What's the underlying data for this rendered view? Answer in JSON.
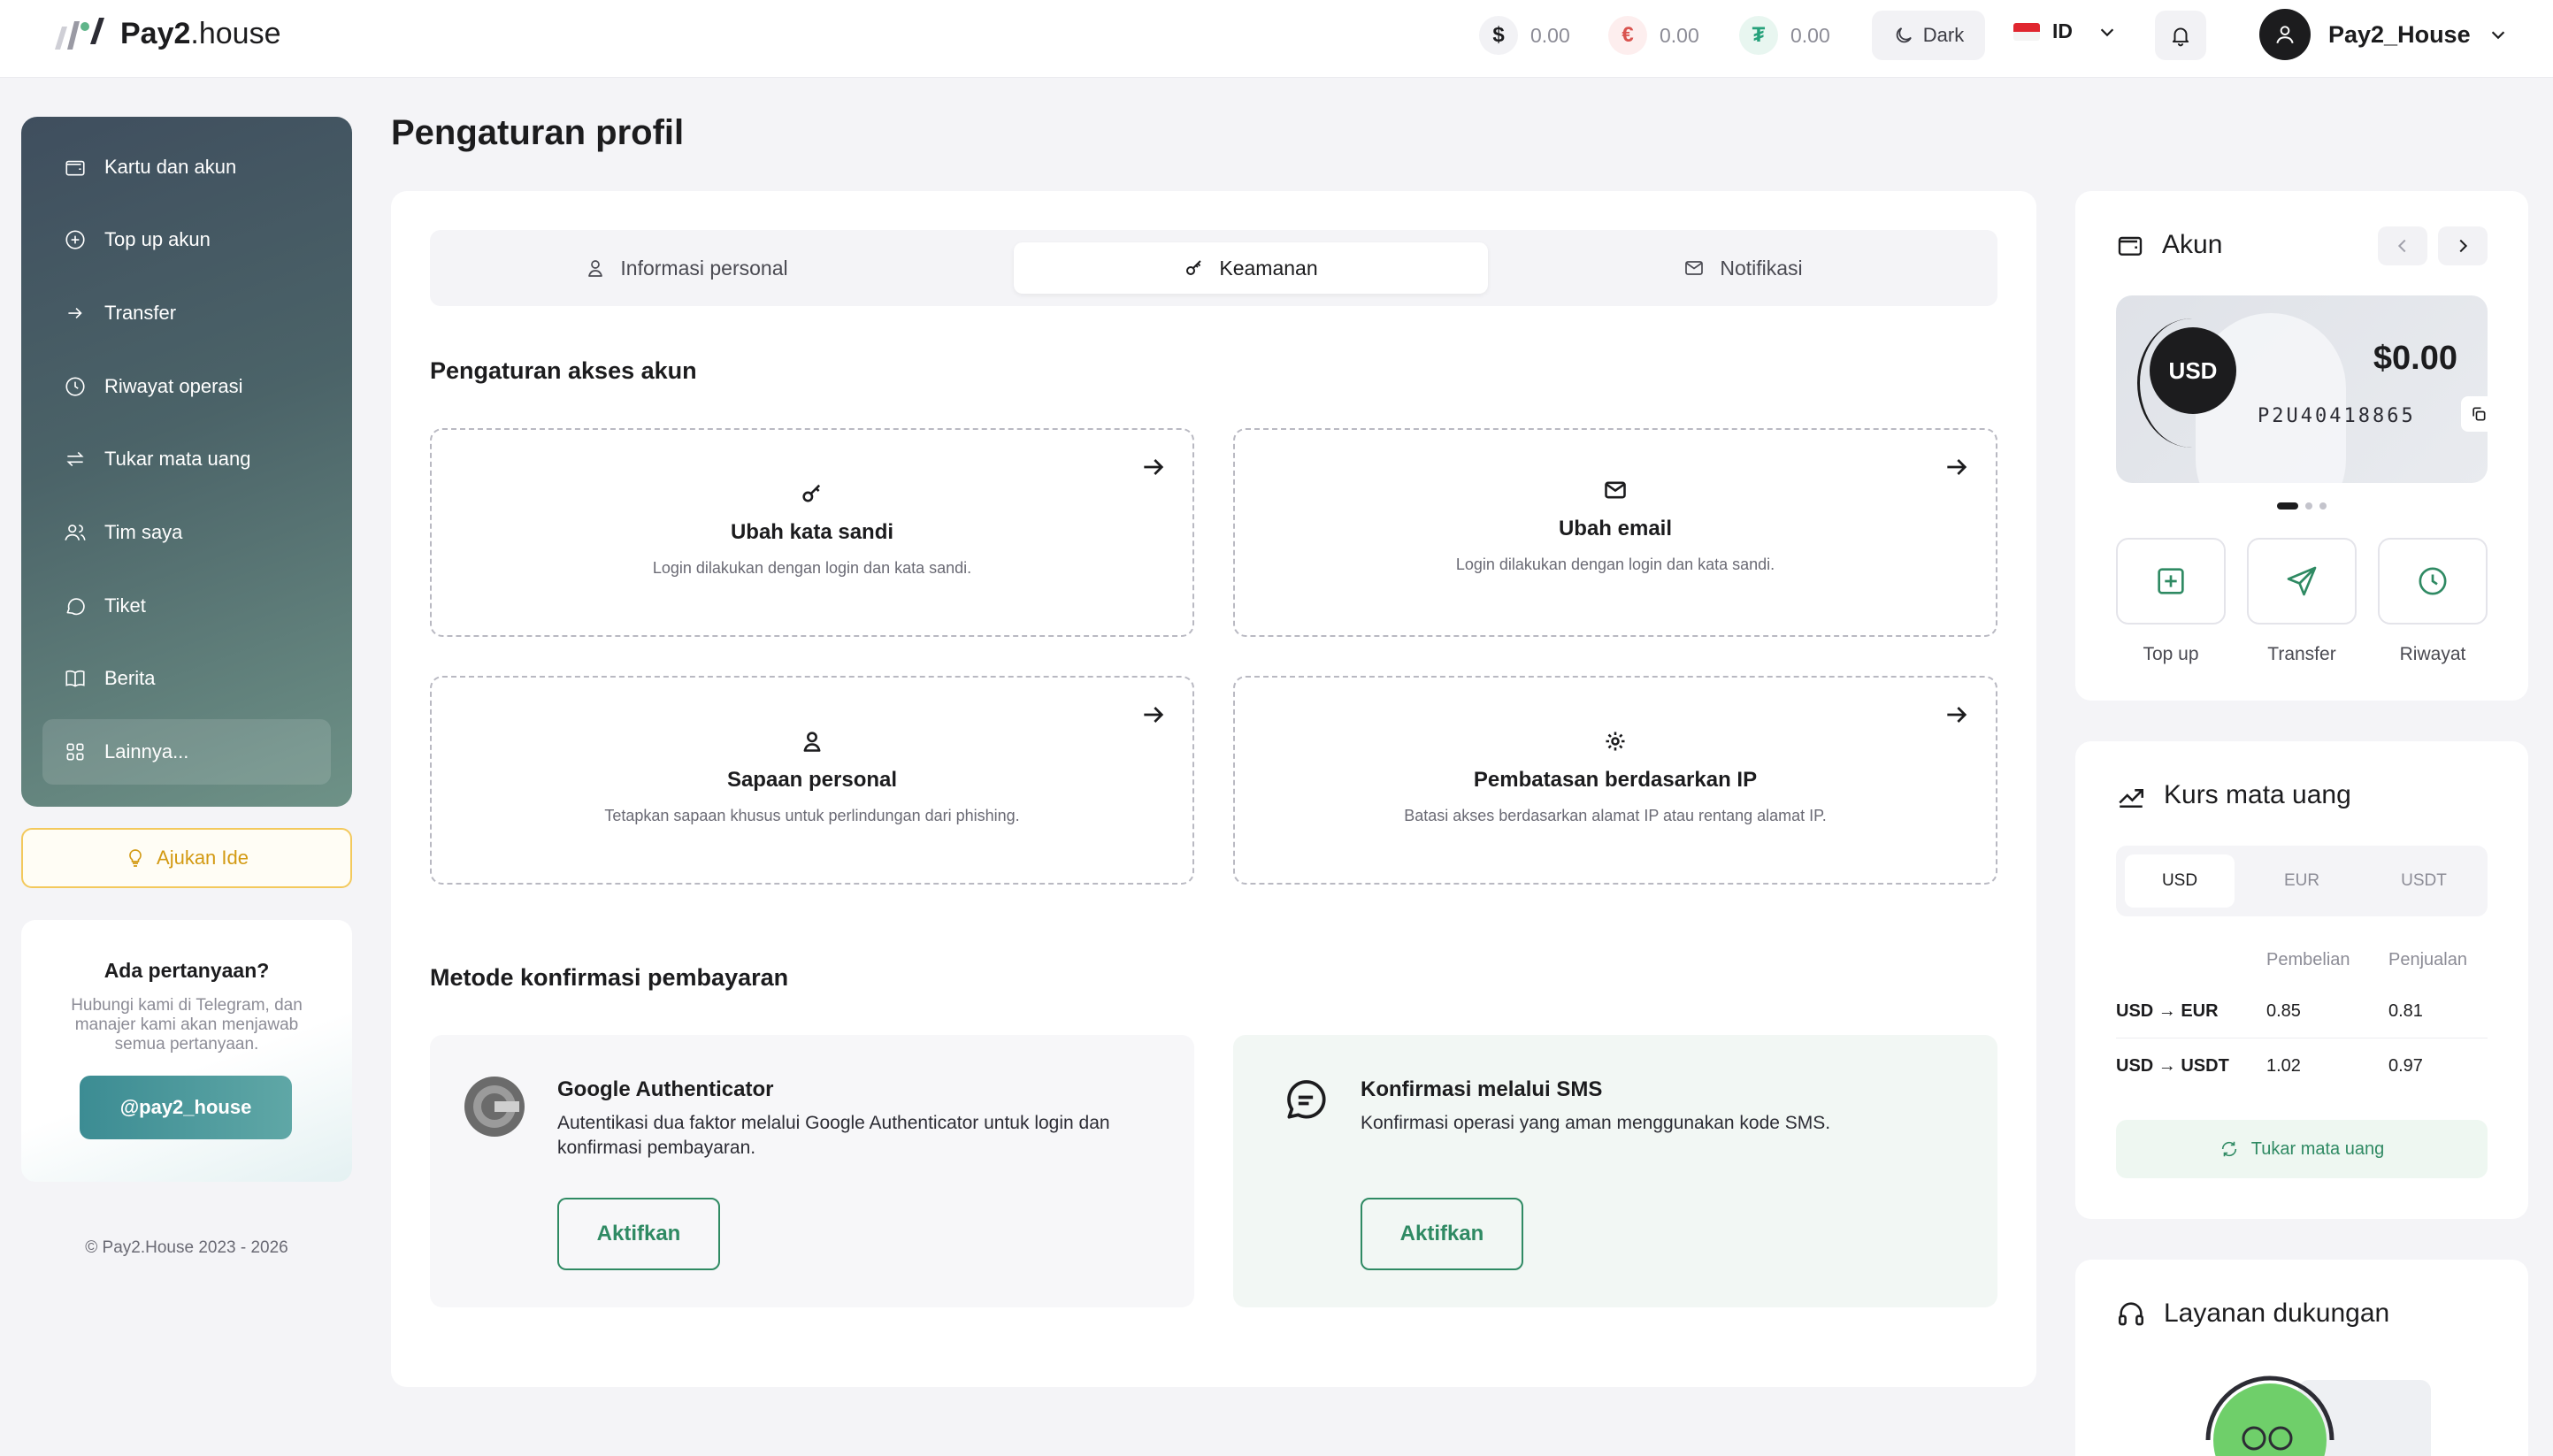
{
  "header": {
    "logo_bold": "Pay2",
    "logo_rest": ".house",
    "balances": [
      {
        "symbol": "$",
        "value": "0.00",
        "color": "#1c1c1e",
        "bg": "#f2f2f5"
      },
      {
        "symbol": "€",
        "value": "0.00",
        "color": "#d9534f",
        "bg": "#fdeeee"
      },
      {
        "symbol": "₮",
        "value": "0.00",
        "color": "#26a17b",
        "bg": "#e8f6f0"
      }
    ],
    "theme_label": "Dark",
    "language": "ID",
    "user_name": "Pay2_House"
  },
  "sidebar": {
    "items": [
      {
        "label": "Kartu dan akun",
        "icon": "wallet-icon"
      },
      {
        "label": "Top up akun",
        "icon": "plus-circle-icon"
      },
      {
        "label": "Transfer",
        "icon": "arrow-right-icon"
      },
      {
        "label": "Riwayat operasi",
        "icon": "clock-icon"
      },
      {
        "label": "Tukar mata uang",
        "icon": "exchange-icon"
      },
      {
        "label": "Tim saya",
        "icon": "team-icon"
      },
      {
        "label": "Tiket",
        "icon": "chat-icon"
      },
      {
        "label": "Berita",
        "icon": "book-icon"
      },
      {
        "label": "Lainnya...",
        "icon": "grid-icon"
      }
    ],
    "idea_label": "Ajukan Ide",
    "help_title": "Ada pertanyaan?",
    "help_text": "Hubungi kami di Telegram, dan manajer kami akan menjawab semua pertanyaan.",
    "telegram_label": "@pay2_house",
    "copyright": "© Pay2.House 2023 - 2026"
  },
  "main": {
    "page_title": "Pengaturan profil",
    "tabs": [
      {
        "label": "Informasi personal"
      },
      {
        "label": "Keamanan"
      },
      {
        "label": "Notifikasi"
      }
    ],
    "access_title": "Pengaturan akses akun",
    "options": [
      {
        "title": "Ubah kata sandi",
        "desc": "Login dilakukan dengan login dan kata sandi."
      },
      {
        "title": "Ubah email",
        "desc": "Login dilakukan dengan login dan kata sandi."
      },
      {
        "title": "Sapaan personal",
        "desc": "Tetapkan sapaan khusus untuk perlindungan dari phishing."
      },
      {
        "title": "Pembatasan berdasarkan IP",
        "desc": "Batasi akses berdasarkan alamat IP atau rentang alamat IP."
      }
    ],
    "confirm_title": "Metode konfirmasi pembayaran",
    "methods": [
      {
        "title": "Google Authenticator",
        "desc": "Autentikasi dua faktor melalui Google Authenticator untuk login dan konfirmasi pembayaran.",
        "button": "Aktifkan"
      },
      {
        "title": "Konfirmasi melalui SMS",
        "desc": "Konfirmasi operasi yang aman menggunakan kode SMS.",
        "button": "Aktifkan"
      }
    ]
  },
  "account": {
    "title": "Akun",
    "currency": "USD",
    "amount": "$0.00",
    "number": "P2U40418865",
    "actions": [
      {
        "label": "Top up"
      },
      {
        "label": "Transfer"
      },
      {
        "label": "Riwayat"
      }
    ]
  },
  "rates": {
    "title": "Kurs mata uang",
    "tabs": [
      "USD",
      "EUR",
      "USDT"
    ],
    "col_buy": "Pembelian",
    "col_sell": "Penjualan",
    "rows": [
      {
        "pair": "USD → EUR",
        "buy": "0.85",
        "sell": "0.81"
      },
      {
        "pair": "USD → USDT",
        "buy": "1.02",
        "sell": "0.97"
      }
    ],
    "swap_label": "Tukar mata uang"
  },
  "support": {
    "title": "Layanan dukungan"
  }
}
